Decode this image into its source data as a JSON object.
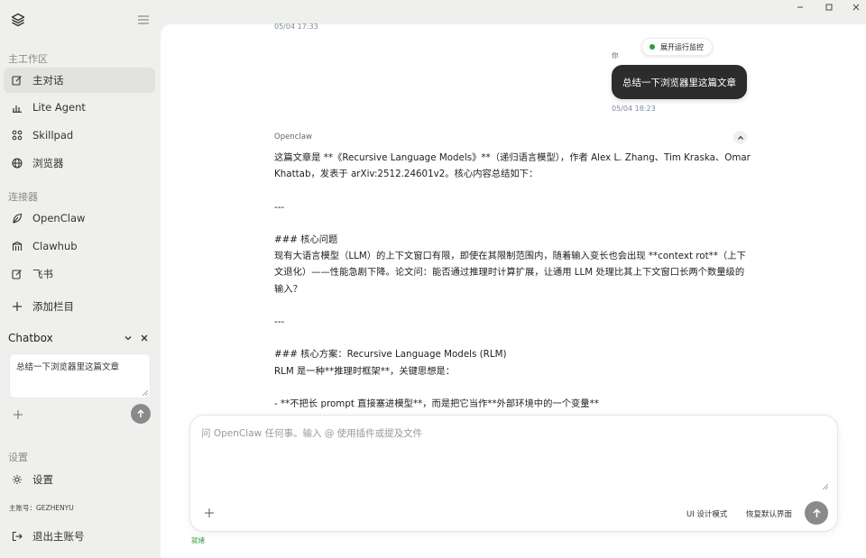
{
  "sidebar": {
    "sections": {
      "workspace": "主工作区",
      "connectors": "连接器",
      "settings": "设置"
    },
    "workspace_items": [
      {
        "label": "主对话",
        "icon": "edit-icon"
      },
      {
        "label": "Lite Agent",
        "icon": "bar-chart-icon"
      },
      {
        "label": "Skillpad",
        "icon": "grid-icon"
      },
      {
        "label": "浏览器",
        "icon": "globe-icon"
      }
    ],
    "connector_items": [
      {
        "label": "OpenClaw",
        "icon": "leaf-icon"
      },
      {
        "label": "Clawhub",
        "icon": "building-icon"
      },
      {
        "label": "飞书",
        "icon": "edit-icon"
      }
    ],
    "add_column": "添加栏目",
    "chatbox": {
      "title": "Chatbox",
      "input_value": "总结一下浏览器里这篇文章"
    },
    "settings_item": "设置",
    "account": "主账号：GEZHENYU",
    "logout": "退出主账号"
  },
  "chat": {
    "prev_timestamp": "05/04 17:33",
    "user_label": "你",
    "monitor_label": "展开运行监控",
    "user_message": "总结一下浏览器里这篇文章",
    "user_timestamp": "05/04 18:23",
    "assistant_name": "Openclaw",
    "assistant_lines": [
      "这篇文章是 **《Recursive Language Models》**（递归语言模型），作者 Alex L. Zhang、Tim Kraska、Omar Khattab，发表于 arXiv:2512.24601v2。核心内容总结如下：",
      "",
      "---",
      "",
      "### 核心问题",
      "现有大语言模型（LLM）的上下文窗口有限，即使在其限制范围内，随着输入变长也会出现 **context rot**（上下文退化）——性能急剧下降。论文问：能否通过推理时计算扩展，让通用 LLM 处理比其上下文窗口长两个数量级的输入？",
      "",
      "---",
      "",
      "### 核心方案：Recursive Language Models (RLM)",
      "RLM 是一种**推理时框架**，关键思想是：",
      "",
      "- **不把长 prompt 直接塞进模型**，而是把它当作**外部环境中的一个变量**"
    ]
  },
  "composer": {
    "placeholder": "问 OpenClaw 任何事。输入 @ 使用插件或提及文件",
    "ui_design_mode": "UI 设计模式",
    "restore_default": "恢复默认界面"
  },
  "status": "就绪"
}
